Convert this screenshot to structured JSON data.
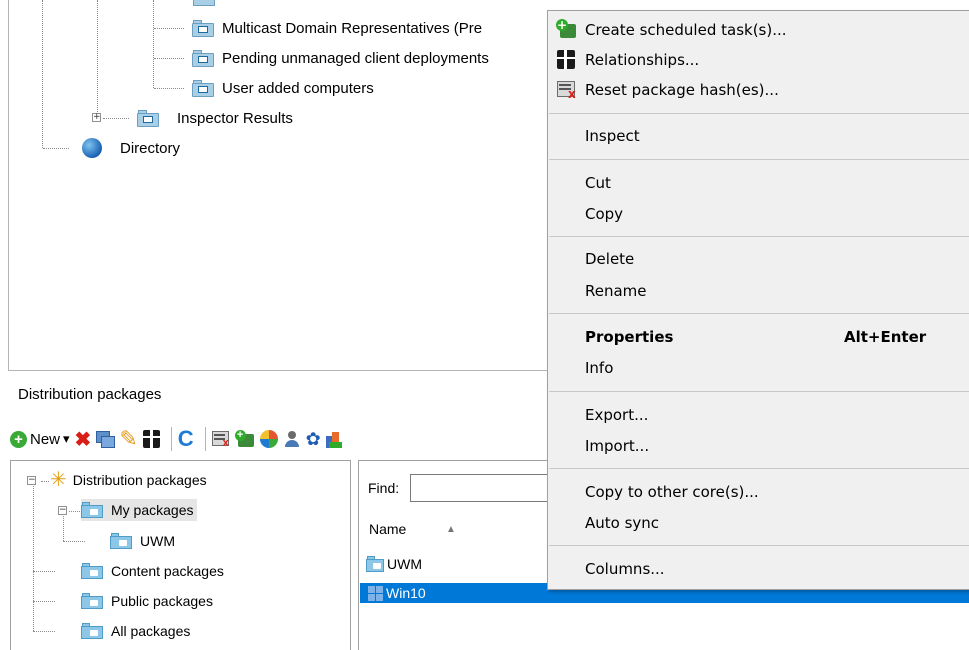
{
  "top_tree": {
    "items": [
      {
        "label": "Multicast Domain Representatives (Pre"
      },
      {
        "label": "Pending unmanaged client deployments"
      },
      {
        "label": "User added computers"
      },
      {
        "label": "Inspector Results"
      },
      {
        "label": "Directory"
      }
    ]
  },
  "section": {
    "title": "Distribution packages"
  },
  "toolbar": {
    "new_label": "New",
    "dropdown_glyph": "▾",
    "delete_glyph": "✖",
    "edit_glyph": "✎",
    "refresh_glyph": "C",
    "settings_glyph": "✿"
  },
  "left_tree": {
    "items": [
      {
        "label": "Distribution packages"
      },
      {
        "label": "My packages"
      },
      {
        "label": "UWM"
      },
      {
        "label": "Content packages"
      },
      {
        "label": "Public packages"
      },
      {
        "label": "All packages"
      }
    ]
  },
  "list": {
    "find_label": "Find:",
    "find_value": "",
    "column_name": "Name",
    "sort_glyph": "▲",
    "rows": [
      {
        "name": "UWM"
      },
      {
        "name": "Win10"
      }
    ]
  },
  "context_menu": {
    "items": [
      {
        "label": "Create scheduled task(s)..."
      },
      {
        "label": "Relationships..."
      },
      {
        "label": "Reset package hash(es)..."
      },
      {
        "label": "Inspect"
      },
      {
        "label": "Cut"
      },
      {
        "label": "Copy"
      },
      {
        "label": "Delete"
      },
      {
        "label": "Rename"
      },
      {
        "label": "Properties",
        "shortcut": "Alt+Enter"
      },
      {
        "label": "Info"
      },
      {
        "label": "Export..."
      },
      {
        "label": "Import..."
      },
      {
        "label": "Copy to other core(s)..."
      },
      {
        "label": "Auto sync"
      },
      {
        "label": "Columns..."
      }
    ]
  },
  "colors": {
    "selection": "#0078d7",
    "menu_bg": "#f0f0f0",
    "delete_red": "#d91e18",
    "refresh_blue": "#1e7bd4",
    "new_green": "#3aa935"
  }
}
